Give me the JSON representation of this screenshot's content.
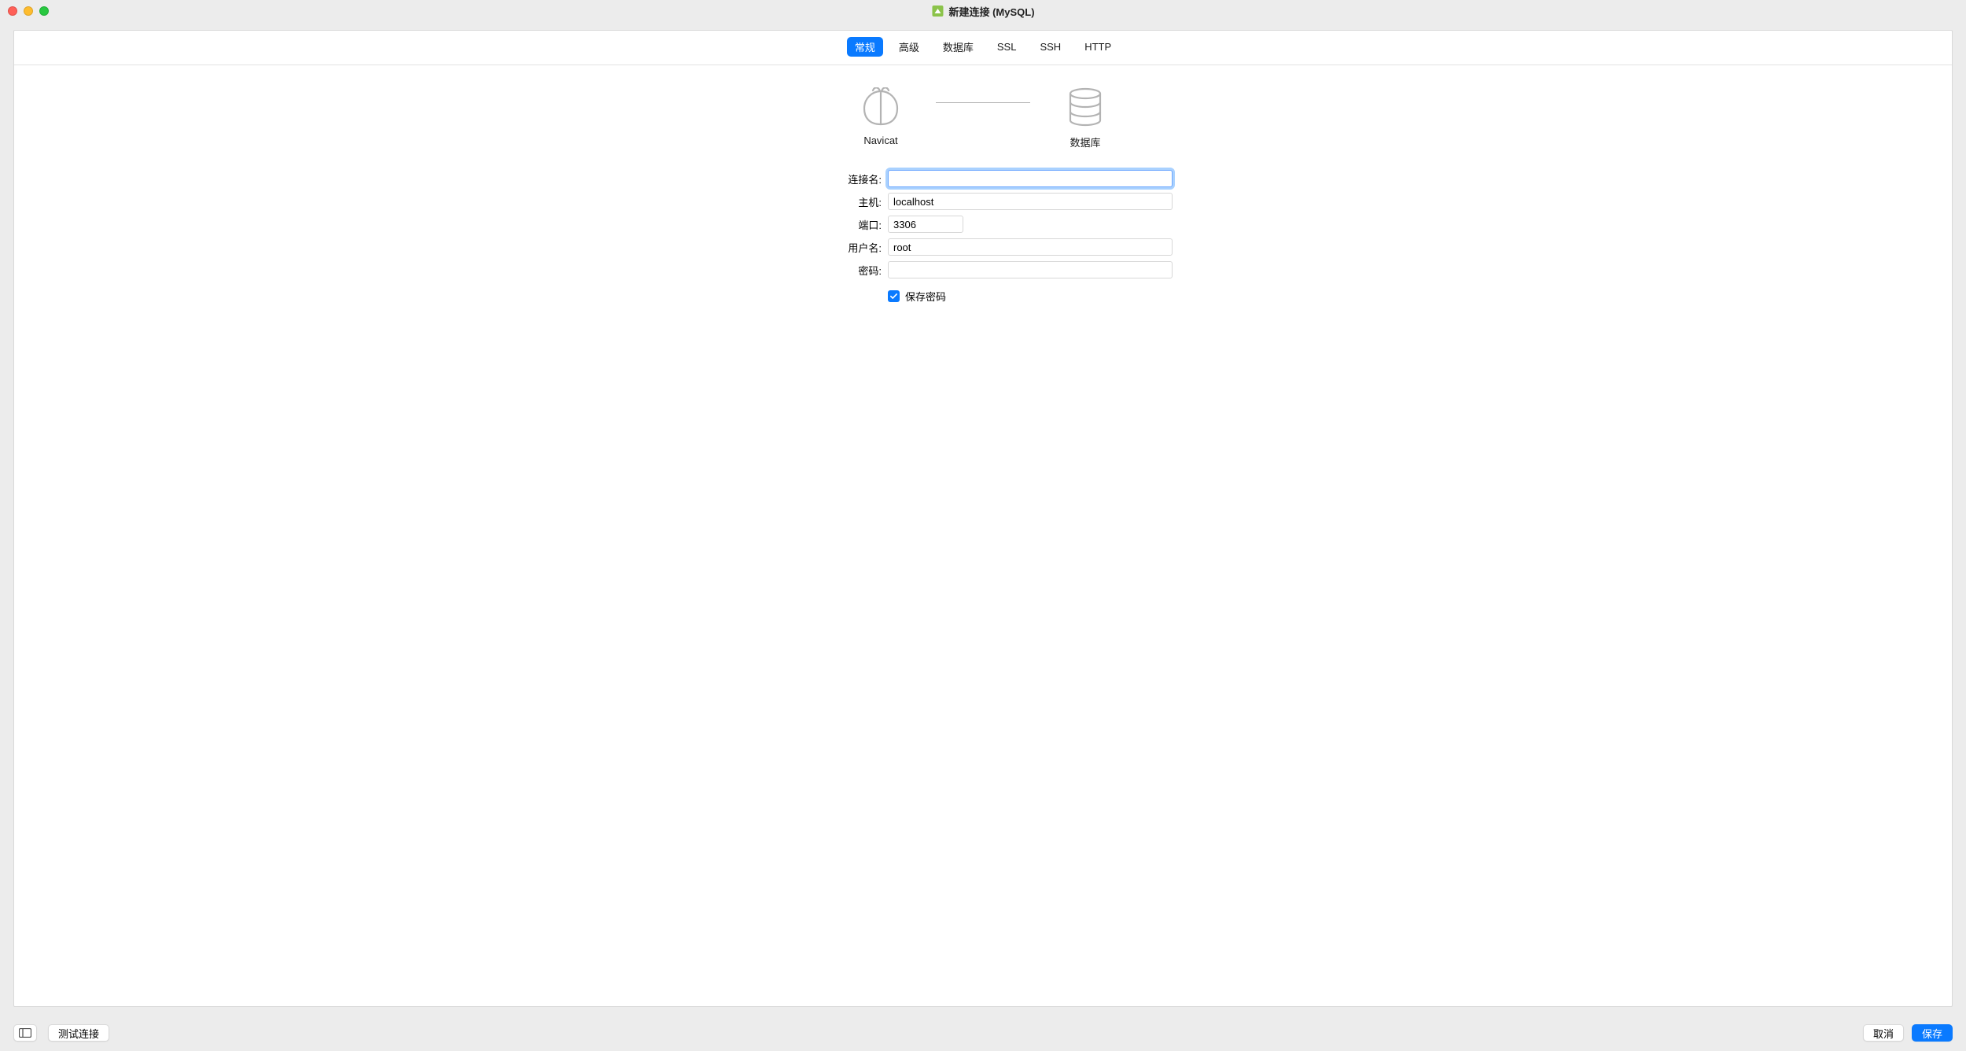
{
  "window": {
    "title": "新建连接 (MySQL)"
  },
  "tabs": [
    {
      "label": "常规",
      "active": true
    },
    {
      "label": "高级",
      "active": false
    },
    {
      "label": "数据库",
      "active": false
    },
    {
      "label": "SSL",
      "active": false
    },
    {
      "label": "SSH",
      "active": false
    },
    {
      "label": "HTTP",
      "active": false
    }
  ],
  "diagram": {
    "left_label": "Navicat",
    "right_label": "数据库"
  },
  "form": {
    "connection_name": {
      "label": "连接名:",
      "value": ""
    },
    "host": {
      "label": "主机:",
      "value": "localhost"
    },
    "port": {
      "label": "端口:",
      "value": "3306"
    },
    "username": {
      "label": "用户名:",
      "value": "root"
    },
    "password": {
      "label": "密码:",
      "value": ""
    },
    "save_password": {
      "label": "保存密码",
      "checked": true
    }
  },
  "footer": {
    "test_connection": "测试连接",
    "cancel": "取消",
    "save": "保存"
  }
}
